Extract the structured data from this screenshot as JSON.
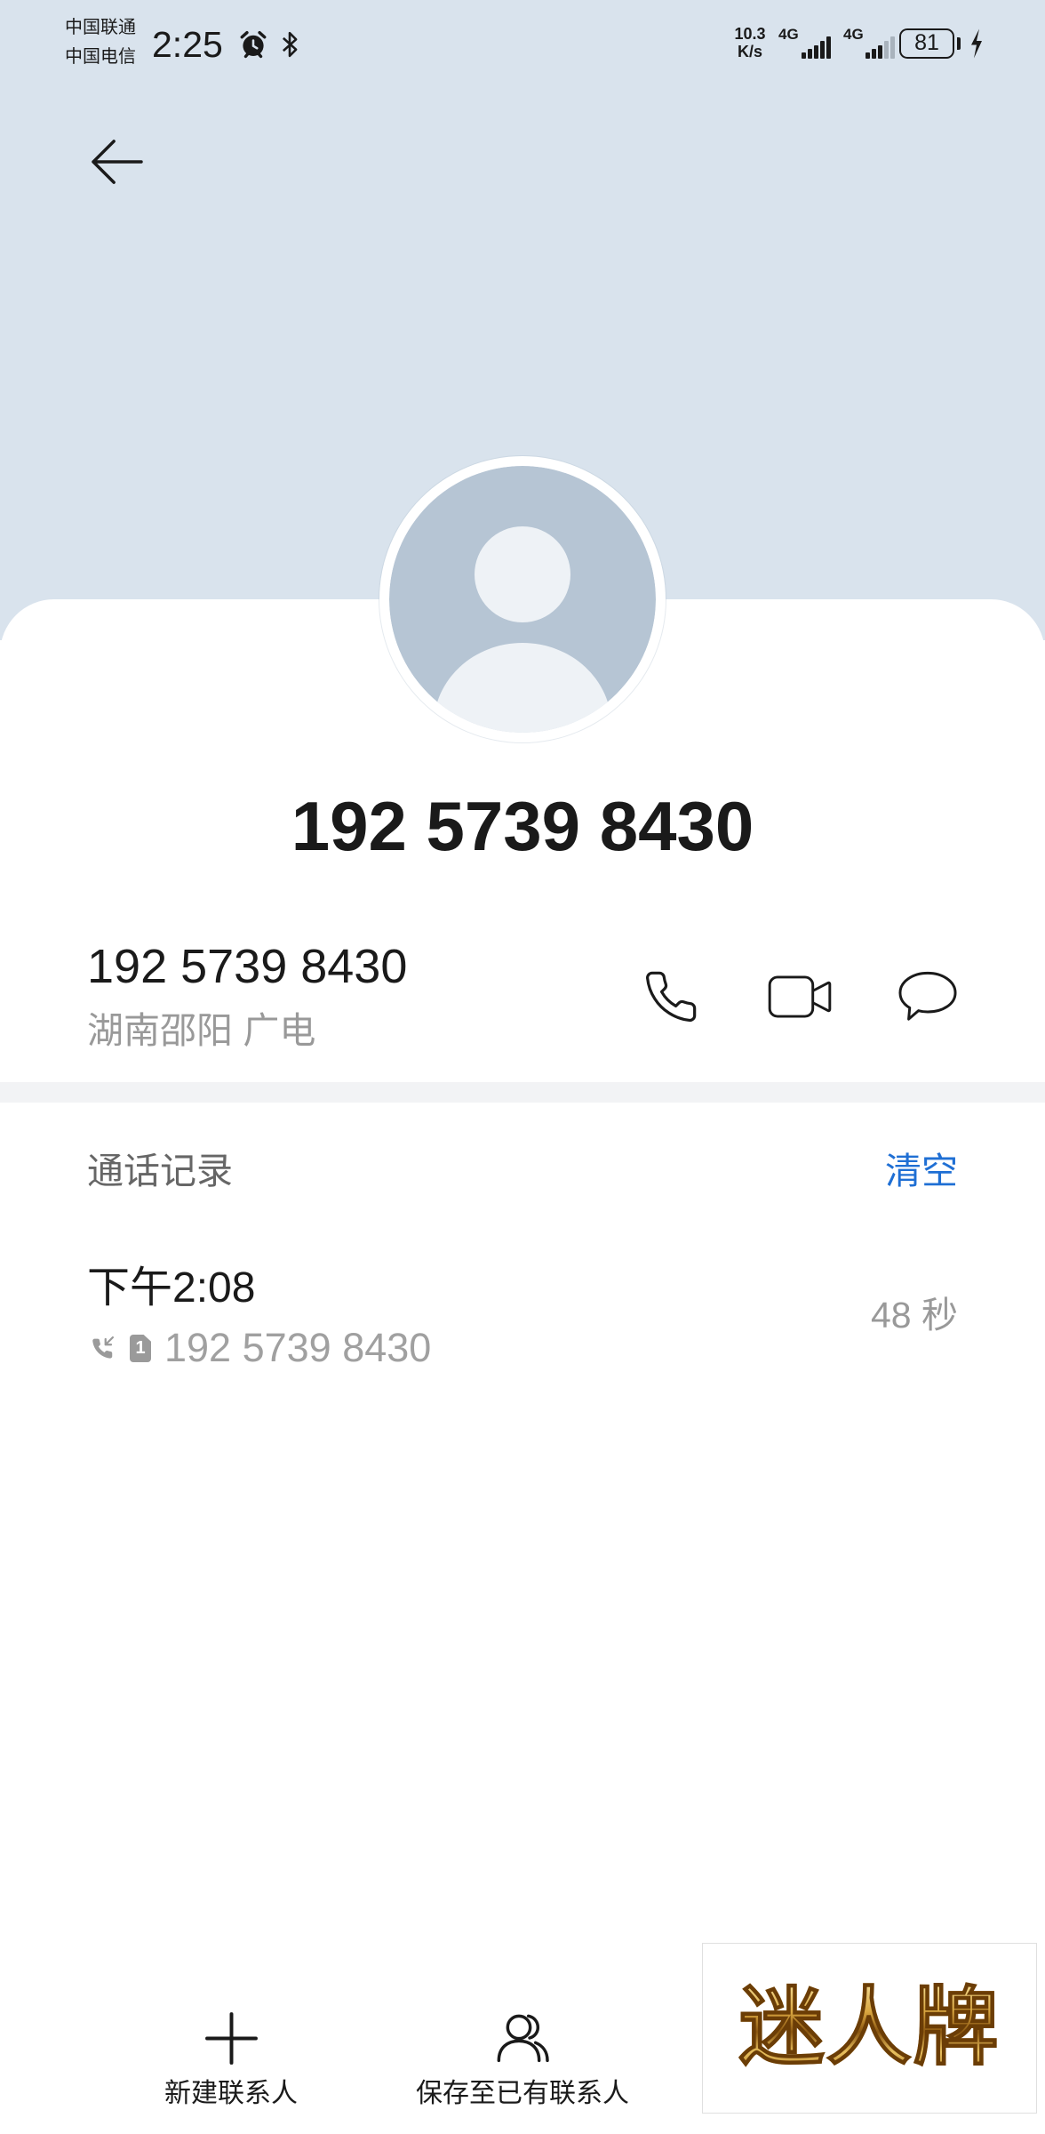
{
  "status_bar": {
    "carriers": [
      "中国联通",
      "中国电信"
    ],
    "time": "2:25",
    "alarm_icon": "alarm-clock-icon",
    "bluetooth_icon": "bluetooth-icon",
    "net_speed": {
      "value": "10.3",
      "unit": "K/s"
    },
    "sim_networks": [
      {
        "type": "4G",
        "signal_level": 5,
        "signal_max": 5
      },
      {
        "type": "4G",
        "signal_level": 3,
        "signal_max": 5
      }
    ],
    "battery": {
      "level": "81",
      "charging": true
    }
  },
  "header": {
    "back_icon": "back-arrow-icon"
  },
  "contact": {
    "avatar_icon": "default-avatar-icon",
    "title": "192 5739 8430",
    "number": "192 5739 8430",
    "location": "湖南邵阳 广电",
    "actions": [
      {
        "icon": "phone-icon"
      },
      {
        "icon": "video-call-icon"
      },
      {
        "icon": "message-icon"
      }
    ]
  },
  "call_log": {
    "heading": "通话记录",
    "clear_label": "清空",
    "entries": [
      {
        "time": "下午2:08",
        "type_icon": "incoming-call-icon",
        "sim": "1",
        "number": "192 5739 8430",
        "duration": "48 秒"
      }
    ]
  },
  "bottom_bar": {
    "items": [
      {
        "icon": "plus-icon",
        "label": "新建联系人"
      },
      {
        "icon": "existing-contact-icon",
        "label": "保存至已有联系人"
      }
    ]
  },
  "watermark": {
    "text": "迷人牌"
  },
  "colors": {
    "header_bg": "#d9e3ed",
    "avatar_bg": "#b6c5d4",
    "accent": "#1f6fd4",
    "text_primary": "#1a1a1a",
    "text_secondary": "#999999",
    "divider": "#f2f3f5"
  }
}
